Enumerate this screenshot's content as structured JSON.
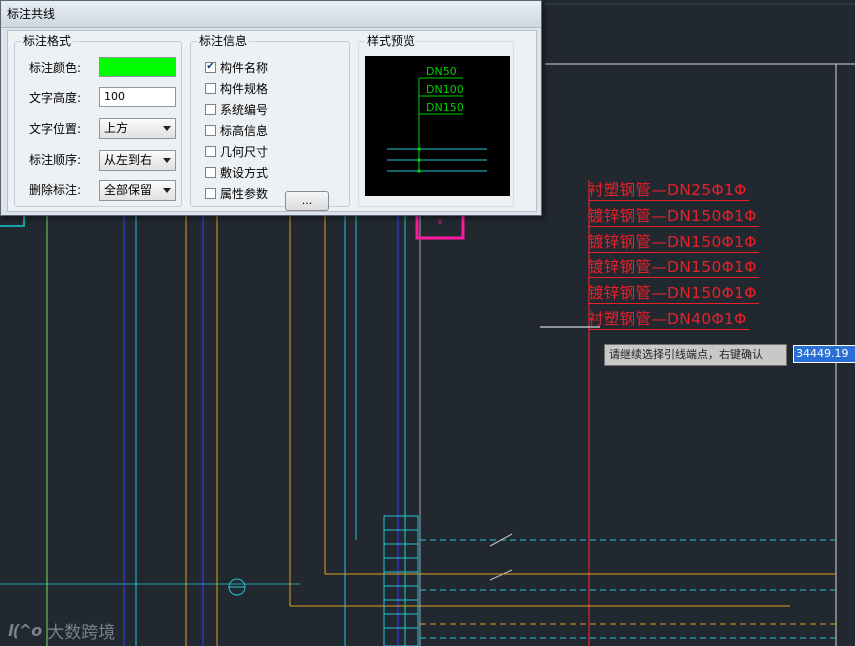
{
  "dialog": {
    "title": "标注共线",
    "format_group": {
      "title": "标注格式",
      "color_label": "标注颜色:",
      "color_value": "#00ff00",
      "height_label": "文字高度:",
      "height_value": "100",
      "position_label": "文字位置:",
      "position_value": "上方",
      "order_label": "标注顺序:",
      "order_value": "从左到右",
      "delete_label": "删除标注:",
      "delete_value": "全部保留"
    },
    "info_group": {
      "title": "标注信息",
      "items": [
        {
          "label": "构件名称",
          "checked": true
        },
        {
          "label": "构件规格",
          "checked": false
        },
        {
          "label": "系统编号",
          "checked": false
        },
        {
          "label": "标高信息",
          "checked": false
        },
        {
          "label": "几何尺寸",
          "checked": false
        },
        {
          "label": "敷设方式",
          "checked": false
        },
        {
          "label": "属性参数",
          "checked": false
        }
      ],
      "more_button": "..."
    },
    "preview_group": {
      "title": "样式预览",
      "labels": [
        "DN50",
        "DN100",
        "DN150"
      ]
    }
  },
  "drawing": {
    "pipe_labels": [
      "衬塑钢管—DN25Φ1Φ",
      "镀锌钢管—DN150Φ1Φ",
      "镀锌钢管—DN150Φ1Φ",
      "镀锌钢管—DN150Φ1Φ",
      "镀锌钢管—DN150Φ1Φ",
      "衬塑钢管—DN40Φ1Φ"
    ],
    "label_color": "#e8202a",
    "prompt": "请继续选择引线端点，右键确认",
    "coordinate": "34449.19"
  },
  "watermark": {
    "logo": "l(^o",
    "text": "大数跨境"
  }
}
